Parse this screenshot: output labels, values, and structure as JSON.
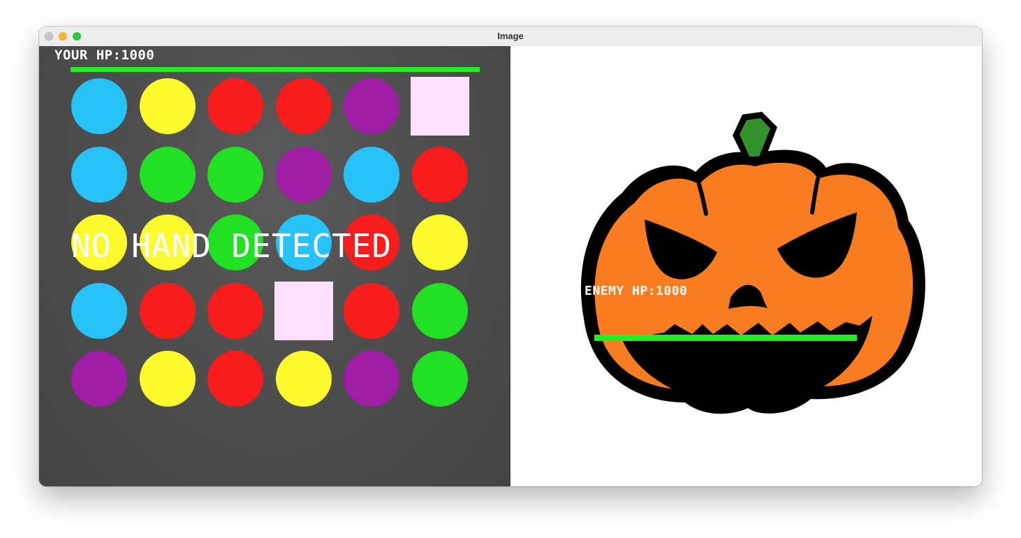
{
  "window": {
    "title": "Image"
  },
  "player": {
    "hp_label": "YOUR HP:1000",
    "hp_fraction": 1.0
  },
  "enemy": {
    "hp_label": "ENEMY HP:1000",
    "hp_fraction": 1.0,
    "sprite": "jack-o-lantern-icon"
  },
  "status": {
    "message": "NO HAND DETECTED"
  },
  "board": {
    "rows": 5,
    "cols": 6,
    "colors": {
      "blue": "#27c2f8",
      "yellow": "#fdfa2d",
      "red": "#f91c1c",
      "purple": "#a01da6",
      "green": "#22e023",
      "pink": "#fddfff"
    },
    "cells": [
      [
        "blue",
        "yellow",
        "red",
        "red",
        "purple",
        "pink-square"
      ],
      [
        "blue",
        "green",
        "green",
        "purple",
        "blue",
        "red"
      ],
      [
        "yellow",
        "yellow",
        "green",
        "blue",
        "red",
        "yellow"
      ],
      [
        "blue",
        "red",
        "red",
        "pink-square",
        "red",
        "green"
      ],
      [
        "purple",
        "yellow",
        "red",
        "yellow",
        "purple",
        "green"
      ]
    ]
  },
  "colors": {
    "hp_bar": "#22ee22",
    "pumpkin_orange": "#f97c20",
    "pumpkin_outline": "#000000",
    "stem": "#33922c"
  }
}
